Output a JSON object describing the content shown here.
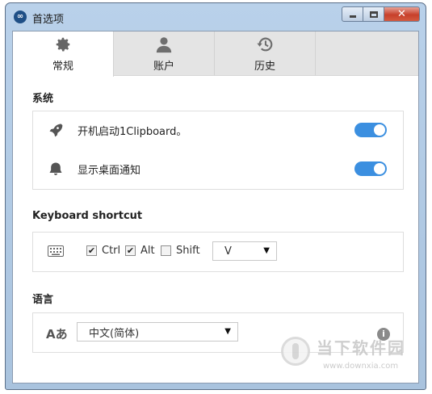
{
  "window": {
    "title": "首选项"
  },
  "tabs": [
    {
      "label": "常规",
      "icon": "gear-icon",
      "active": true
    },
    {
      "label": "账户",
      "icon": "user-icon",
      "active": false
    },
    {
      "label": "历史",
      "icon": "history-icon",
      "active": false
    }
  ],
  "system": {
    "title": "系统",
    "rows": [
      {
        "label": "开机启动1Clipboard。",
        "icon": "rocket-icon",
        "enabled": true
      },
      {
        "label": "显示桌面通知",
        "icon": "bell-icon",
        "enabled": true
      }
    ]
  },
  "keyboard": {
    "title": "Keyboard shortcut",
    "modifiers": [
      {
        "label": "Ctrl",
        "checked": true,
        "mark": "✔"
      },
      {
        "label": "Alt",
        "checked": true,
        "mark": "✔"
      },
      {
        "label": "Shift",
        "checked": false,
        "mark": ""
      }
    ],
    "key": "V"
  },
  "language": {
    "title": "语言",
    "selected": "中文(简体)",
    "icon_text": "Aあ",
    "info_text": "i"
  },
  "watermark": {
    "brand": "当下软件园",
    "url": "www.downxia.com"
  },
  "colors": {
    "toggle_on": "#3b8fe0",
    "close_button": "#c7402b"
  }
}
